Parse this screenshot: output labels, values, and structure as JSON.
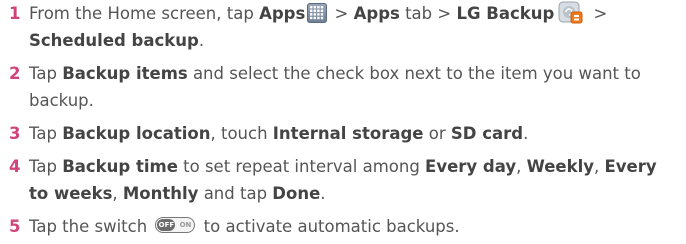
{
  "steps": [
    {
      "num": "1",
      "segments": [
        {
          "t": "From the Home screen, tap "
        },
        {
          "t": "Apps",
          "b": true
        },
        {
          "icon": "apps-icon"
        },
        {
          "t": " > "
        },
        {
          "t": "Apps",
          "b": true
        },
        {
          "t": " tab > "
        },
        {
          "t": "LG Backup",
          "b": true
        },
        {
          "icon": "lg-backup-icon"
        },
        {
          "t": " > "
        },
        {
          "t": "Scheduled backup",
          "b": true
        },
        {
          "t": "."
        }
      ]
    },
    {
      "num": "2",
      "segments": [
        {
          "t": "Tap "
        },
        {
          "t": "Backup items",
          "b": true
        },
        {
          "t": " and select the check box next to the item you want to backup."
        }
      ]
    },
    {
      "num": "3",
      "segments": [
        {
          "t": "Tap "
        },
        {
          "t": "Backup location",
          "b": true
        },
        {
          "t": ", touch "
        },
        {
          "t": "Internal storage",
          "b": true
        },
        {
          "t": " or "
        },
        {
          "t": "SD card",
          "b": true
        },
        {
          "t": "."
        }
      ]
    },
    {
      "num": "4",
      "segments": [
        {
          "t": "Tap "
        },
        {
          "t": "Backup time",
          "b": true
        },
        {
          "t": " to set repeat interval among "
        },
        {
          "t": "Every day",
          "b": true
        },
        {
          "t": ", "
        },
        {
          "t": "Weekly",
          "b": true
        },
        {
          "t": ", "
        },
        {
          "t": "Every to weeks",
          "b": true
        },
        {
          "t": ", "
        },
        {
          "t": "Monthly",
          "b": true
        },
        {
          "t": " and tap "
        },
        {
          "t": "Done",
          "b": true
        },
        {
          "t": "."
        }
      ]
    },
    {
      "num": "5",
      "segments": [
        {
          "t": "Tap the switch "
        },
        {
          "icon": "toggle-switch-icon"
        },
        {
          "t": " to activate automatic backups."
        }
      ]
    }
  ],
  "toggle": {
    "off_label": "OFF",
    "on_label": "ON"
  },
  "colors": {
    "step_number": "#d1447b",
    "body_text": "#555555",
    "bold_text": "#444444"
  }
}
